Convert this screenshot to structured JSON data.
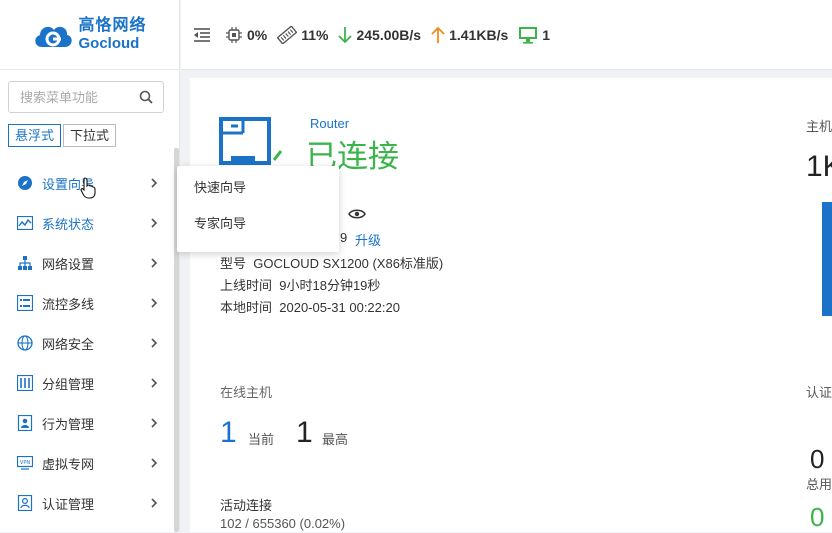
{
  "brand": {
    "cn": "高恪网络",
    "en": "Gocloud"
  },
  "search": {
    "placeholder": "搜索菜单功能"
  },
  "mode_tabs": [
    "悬浮式",
    "下拉式"
  ],
  "menu": [
    {
      "label": "设置向导",
      "icon": "compass-icon",
      "active": true
    },
    {
      "label": "系统状态",
      "icon": "chart-icon",
      "active": true
    },
    {
      "label": "网络设置",
      "icon": "network-icon",
      "active": false
    },
    {
      "label": "流控多线",
      "icon": "list-icon",
      "active": false
    },
    {
      "label": "网络安全",
      "icon": "globe-icon",
      "active": false
    },
    {
      "label": "分组管理",
      "icon": "group-icon",
      "active": false
    },
    {
      "label": "行为管理",
      "icon": "behavior-icon",
      "active": false
    },
    {
      "label": "虚拟专网",
      "icon": "vpn-icon",
      "active": false
    },
    {
      "label": "认证管理",
      "icon": "auth-icon",
      "active": false
    }
  ],
  "submenu": [
    "快速向导",
    "专家向导"
  ],
  "topbar": {
    "cpu": "0%",
    "memory": "11%",
    "download": "245.00B/s",
    "upload": "1.41KB/s",
    "devices": "1"
  },
  "device": {
    "kind": "Router",
    "status": "已连接",
    "version_tail": "9",
    "upgrade": "升级",
    "model_label": "型号",
    "model": "GOCLOUD SX1200 (X86标准版)",
    "uptime_label": "上线时间",
    "uptime": "9小时18分钟19秒",
    "localtime_label": "本地时间",
    "localtime": "2020-05-31 00:22:20"
  },
  "hosts": {
    "title": "在线主机",
    "current": "1",
    "current_label": "当前",
    "max": "1",
    "max_label": "最高"
  },
  "connections": {
    "title": "活动连接",
    "value": "102 / 655360 (0.02%)"
  },
  "right_panel": {
    "host_title": "主机",
    "host_value": "1K",
    "auth_title": "认证",
    "auth_value": "0",
    "auth_sub": "总用",
    "auth_green": "0"
  },
  "colors": {
    "accent": "#1a73c8",
    "green": "#3bb54a",
    "orange": "#f08c1a"
  }
}
